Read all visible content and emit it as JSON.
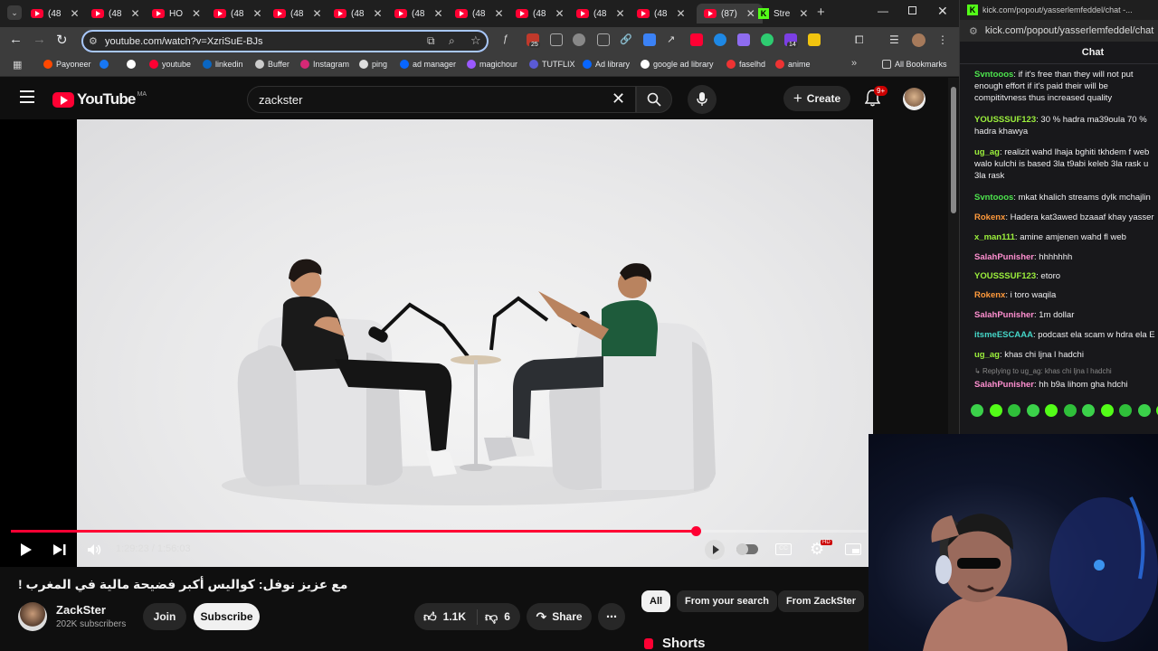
{
  "browser": {
    "tabs": [
      {
        "label": "(48"
      },
      {
        "label": "(48"
      },
      {
        "label": "HO"
      },
      {
        "label": "(48"
      },
      {
        "label": "(48"
      },
      {
        "label": "(48"
      },
      {
        "label": "(48"
      },
      {
        "label": "(48"
      },
      {
        "label": "(48"
      },
      {
        "label": "(48"
      },
      {
        "label": "(48"
      },
      {
        "label": "(87)"
      },
      {
        "label": "Stre"
      }
    ],
    "url": "youtube.com/watch?v=XzriSuE-BJs",
    "extension_badges": {
      "first": "25",
      "second": "14"
    },
    "bookmarks": [
      {
        "label": "Payoneer",
        "color": "#ff4800"
      },
      {
        "label": "",
        "color": "#1877f2"
      },
      {
        "label": "",
        "color": "#ffffff"
      },
      {
        "label": "youtube",
        "color": "#ff0033"
      },
      {
        "label": "linkedin",
        "color": "#0a66c2"
      },
      {
        "label": "Buffer",
        "color": "#cccccc"
      },
      {
        "label": "Instagram",
        "color": "#d62976"
      },
      {
        "label": "ping",
        "color": "#dddddd"
      },
      {
        "label": "ad manager",
        "color": "#0866ff"
      },
      {
        "label": "magichour",
        "color": "#9b59ff"
      },
      {
        "label": "TUTFLIX",
        "color": "#5b5bd6"
      },
      {
        "label": "Ad library",
        "color": "#0866ff"
      },
      {
        "label": "google ad library",
        "color": "#ffffff"
      },
      {
        "label": "faselhd",
        "color": "#e33"
      },
      {
        "label": "anime",
        "color": "#e33"
      }
    ],
    "all_bookmarks": "All Bookmarks"
  },
  "youtube": {
    "logo_text": "YouTube",
    "region": "MA",
    "search_query": "zackster",
    "create_label": "Create",
    "notif_count": "9+",
    "video": {
      "time_current": "1:29:23",
      "time_total": "1:56:03",
      "progress": 0.8,
      "title": "مع عزيز نوفل: كواليس أكبر فضيحة مالية في المغرب !",
      "hd_badge": "HD"
    },
    "channel": {
      "name": "ZackSter",
      "subscribers": "202K subscribers",
      "join_label": "Join",
      "subscribe_label": "Subscribe"
    },
    "actions": {
      "likes": "1.1K",
      "dislikes": "6",
      "share_label": "Share"
    },
    "chips": [
      "All",
      "From your search",
      "From ZackSter"
    ],
    "shorts_label": "Shorts"
  },
  "kick": {
    "url": "kick.com/popout/yasserlemfeddel/chat",
    "tab_title": "kick.com/popout/yasserlemfeddel/chat -...",
    "chat_title": "Chat",
    "messages": [
      {
        "user": "Svntooos",
        "color": "#4de34d",
        "text": "if it's free than they will not put enough effort if it's paid their will be compititvness thus increased quality"
      },
      {
        "user": "YOUSSSUF123",
        "color": "#9cf03c",
        "text": "30 % hadra ma39oula 70 % hadra khawya"
      },
      {
        "user": "ug_ag",
        "color": "#9cf03c",
        "text": "realizit wahd lhaja bghiti tkhdem f web walo kulchi is based 3la t9abi keleb 3la rask u 3la rask"
      },
      {
        "user": "Svntooos",
        "color": "#4de34d",
        "text": "mkat khalich streams dylk mchajlin"
      },
      {
        "user": "Rokenx",
        "color": "#ff9a3c",
        "text": "Hadera kat3awed bzaaaf khay yasser"
      },
      {
        "user": "x_man111",
        "color": "#9cf03c",
        "text": "amine amjenen wahd fl web"
      },
      {
        "user": "SalahPunisher",
        "color": "#ff8fd0",
        "text": "hhhhhhh"
      },
      {
        "user": "YOUSSSUF123",
        "color": "#9cf03c",
        "text": "etoro"
      },
      {
        "user": "Rokenx",
        "color": "#ff9a3c",
        "text": "i toro waqila"
      },
      {
        "user": "SalahPunisher",
        "color": "#ff8fd0",
        "text": "1m dollar"
      },
      {
        "user": "itsmeESCAAA",
        "color": "#45d6c8",
        "text": "podcast ela scam w hdra ela E"
      },
      {
        "user": "ug_ag",
        "color": "#9cf03c",
        "text": "khas chi ljna l hadchi"
      },
      {
        "user": "SalahPunisher",
        "color": "#ff8fd0",
        "text": "hh b9a lihom gha hdchi"
      }
    ],
    "reply_note": "Replying to ug_ag: khas chi ljna l hadchi"
  }
}
